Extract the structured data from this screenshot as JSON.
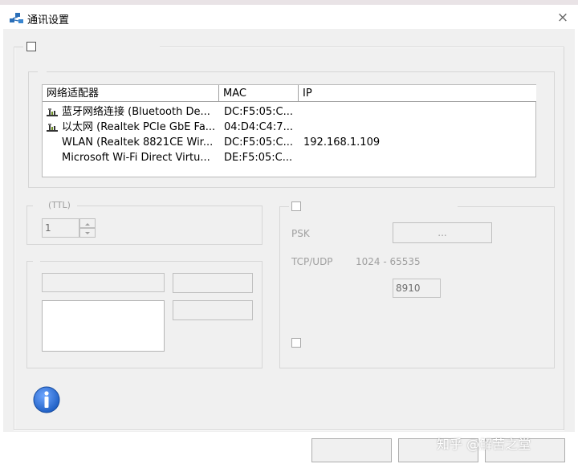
{
  "window": {
    "title": "通讯设置",
    "close_glyph": "×",
    "app_icon": "network-share-icon"
  },
  "adapters": {
    "columns": [
      "网络适配器",
      "MAC",
      "IP"
    ],
    "rows": [
      {
        "name": "蓝牙网络连接 (Bluetooth De...",
        "mac": "DC:F5:05:C...",
        "ip": "",
        "icon": "network-adapter-icon"
      },
      {
        "name": "以太网 (Realtek PCIe GbE Fa...",
        "mac": "04:D4:C4:7...",
        "ip": "",
        "icon": "network-adapter-icon"
      },
      {
        "name": "WLAN (Realtek 8821CE Wir...",
        "mac": "DC:F5:05:C...",
        "ip": "192.168.1.109",
        "icon": ""
      },
      {
        "name": "Microsoft Wi-Fi Direct Virtu...",
        "mac": "DE:F5:05:C...",
        "ip": "",
        "icon": ""
      }
    ]
  },
  "ttl": {
    "group_title": "(TTL)",
    "value": "1"
  },
  "security": {
    "psk_label": "PSK",
    "psk_button": "...",
    "port_label": "TCP/UDP",
    "port_range": "1024 - 65535",
    "port_value": "8910"
  },
  "watermark": "知乎 @解苦之堂",
  "colors": {
    "client_bg": "#f0f0f0",
    "info_blue": "#1f5fc4"
  }
}
